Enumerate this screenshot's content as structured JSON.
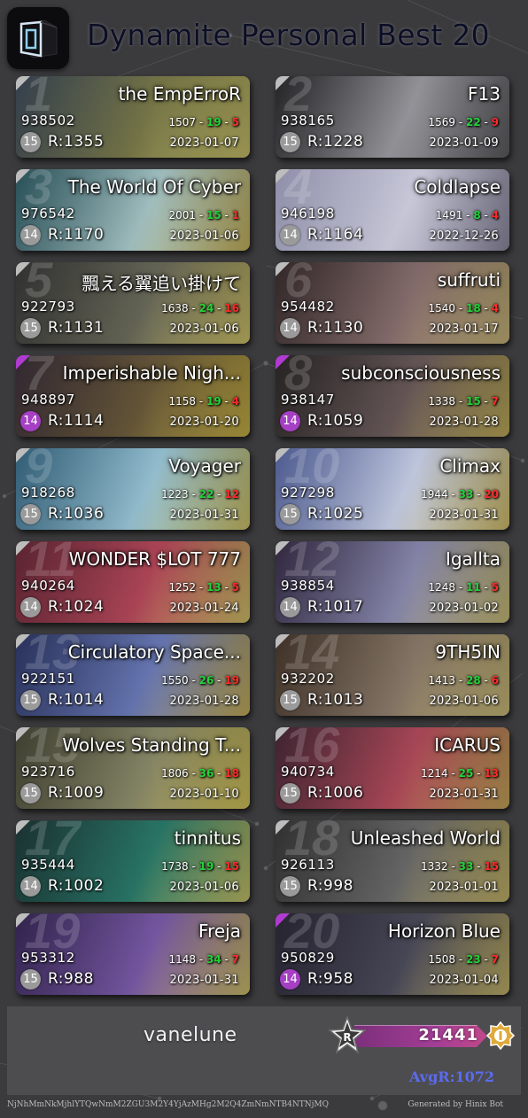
{
  "header": {
    "title": "Dynamite Personal Best 20",
    "logo_icon": "cube-logo-icon"
  },
  "theme": {
    "background": "#3b3b3d",
    "good_color": "#23d23a",
    "miss_color": "#ff2a2a",
    "diff_default_color": "#9a9a9a",
    "diff_14p_color": "#a53fc3",
    "avg_color": "#5b6cf0"
  },
  "cards": [
    {
      "rank": "1",
      "title": "the EmpErroR",
      "score": "938502",
      "perfect": "1507",
      "good": "19",
      "miss": "5",
      "level": "15",
      "rating": "R:1355",
      "date": "2023-01-07",
      "plus": false,
      "art": [
        "#3d4a5a",
        "#7a7a4a",
        "#c9c26a"
      ]
    },
    {
      "rank": "2",
      "title": "F13",
      "score": "938165",
      "perfect": "1569",
      "good": "22",
      "miss": "9",
      "level": "15",
      "rating": "R:1228",
      "date": "2023-01-09",
      "plus": false,
      "art": [
        "#2b2b2e",
        "#9a9aa0",
        "#5c5c60"
      ]
    },
    {
      "rank": "3",
      "title": "The World Of Cyber",
      "score": "976542",
      "perfect": "2001",
      "good": "15",
      "miss": "1",
      "level": "14",
      "rating": "R:1170",
      "date": "2023-01-06",
      "plus": false,
      "art": [
        "#2f5d66",
        "#a8c7c8",
        "#c7b35c"
      ]
    },
    {
      "rank": "4",
      "title": "Coldlapse",
      "score": "946198",
      "perfect": "1491",
      "good": "8",
      "miss": "4",
      "level": "14",
      "rating": "R:1164",
      "date": "2022-12-26",
      "plus": false,
      "art": [
        "#a8a8c8",
        "#d2d2e4",
        "#8d8aa0"
      ]
    },
    {
      "rank": "5",
      "title": "飄える翼追い掛けて",
      "score": "922793",
      "perfect": "1638",
      "good": "24",
      "miss": "16",
      "level": "15",
      "rating": "R:1131",
      "date": "2023-01-06",
      "plus": false,
      "art": [
        "#3a3a3a",
        "#6a6a5a",
        "#d0c46a"
      ]
    },
    {
      "rank": "6",
      "title": "suffruti",
      "score": "954482",
      "perfect": "1540",
      "good": "18",
      "miss": "4",
      "level": "14",
      "rating": "R:1130",
      "date": "2023-01-17",
      "plus": false,
      "art": [
        "#3b2e2e",
        "#8a7070",
        "#c9b77a"
      ]
    },
    {
      "rank": "7",
      "title": "Imperishable Nigh...",
      "score": "948897",
      "perfect": "1158",
      "good": "19",
      "miss": "4",
      "level": "14",
      "rating": "R:1114",
      "date": "2023-01-20",
      "plus": true,
      "art": [
        "#3a2f3a",
        "#6a5a3a",
        "#c9b246"
      ]
    },
    {
      "rank": "8",
      "title": "subconsciousness",
      "score": "938147",
      "perfect": "1338",
      "good": "15",
      "miss": "7",
      "level": "14",
      "rating": "R:1059",
      "date": "2023-01-28",
      "plus": true,
      "art": [
        "#2e2a2a",
        "#6a5a5a",
        "#c0ae5a"
      ]
    },
    {
      "rank": "9",
      "title": "Voyager",
      "score": "918268",
      "perfect": "1223",
      "good": "22",
      "miss": "12",
      "level": "15",
      "rating": "R:1036",
      "date": "2023-01-31",
      "plus": false,
      "art": [
        "#3a6d8a",
        "#9ac6d8",
        "#d0c468"
      ]
    },
    {
      "rank": "10",
      "title": "Climax",
      "score": "927298",
      "perfect": "1944",
      "good": "33",
      "miss": "20",
      "level": "15",
      "rating": "R:1025",
      "date": "2023-01-31",
      "plus": false,
      "art": [
        "#5a6aa8",
        "#c8d0e8",
        "#d4c06a"
      ]
    },
    {
      "rank": "11",
      "title": "WONDER $LOT 777",
      "score": "940264",
      "perfect": "1252",
      "good": "13",
      "miss": "5",
      "level": "14",
      "rating": "R:1024",
      "date": "2023-01-24",
      "plus": false,
      "art": [
        "#6a2a3a",
        "#b4485a",
        "#d4c46a"
      ]
    },
    {
      "rank": "12",
      "title": "Igallta",
      "score": "938854",
      "perfect": "1248",
      "good": "11",
      "miss": "5",
      "level": "14",
      "rating": "R:1017",
      "date": "2023-01-02",
      "plus": false,
      "art": [
        "#3a2f4a",
        "#8a8ab0",
        "#cabe76"
      ]
    },
    {
      "rank": "13",
      "title": "Circulatory Space...",
      "score": "922151",
      "perfect": "1550",
      "good": "26",
      "miss": "19",
      "level": "15",
      "rating": "R:1014",
      "date": "2023-01-28",
      "plus": false,
      "art": [
        "#2f3a6a",
        "#6a7ab8",
        "#c8b05a"
      ]
    },
    {
      "rank": "14",
      "title": "9TH5IN",
      "score": "932202",
      "perfect": "1413",
      "good": "28",
      "miss": "6",
      "level": "15",
      "rating": "R:1013",
      "date": "2023-01-06",
      "plus": false,
      "art": [
        "#4a3a2e",
        "#8a7a6a",
        "#cdbd7a"
      ]
    },
    {
      "rank": "15",
      "title": "Wolves Standing T...",
      "score": "923716",
      "perfect": "1806",
      "good": "36",
      "miss": "18",
      "level": "15",
      "rating": "R:1009",
      "date": "2023-01-10",
      "plus": false,
      "art": [
        "#4a4a3a",
        "#8a8a6a",
        "#d6c65a"
      ]
    },
    {
      "rank": "16",
      "title": "ICARUS",
      "score": "940734",
      "perfect": "1214",
      "good": "25",
      "miss": "13",
      "level": "15",
      "rating": "R:1006",
      "date": "2023-01-31",
      "plus": false,
      "art": [
        "#4a2a3a",
        "#b04a5a",
        "#c8a85a"
      ]
    },
    {
      "rank": "17",
      "title": "tinnitus",
      "score": "935444",
      "perfect": "1738",
      "good": "19",
      "miss": "15",
      "level": "14",
      "rating": "R:1002",
      "date": "2023-01-06",
      "plus": false,
      "art": [
        "#1f3a3a",
        "#2a7a6a",
        "#c8c46a"
      ]
    },
    {
      "rank": "18",
      "title": "Unleashed World",
      "score": "926113",
      "perfect": "1332",
      "good": "33",
      "miss": "15",
      "level": "15",
      "rating": "R:998",
      "date": "2023-01-01",
      "plus": false,
      "art": [
        "#3a3a3a",
        "#6a6a6a",
        "#c6b66a"
      ]
    },
    {
      "rank": "19",
      "title": "Freja",
      "score": "953312",
      "perfect": "1148",
      "good": "34",
      "miss": "7",
      "level": "15",
      "rating": "R:988",
      "date": "2023-01-31",
      "plus": false,
      "art": [
        "#3a2a5a",
        "#7a5aa8",
        "#d0c06a"
      ]
    },
    {
      "rank": "20",
      "title": "Horizon Blue",
      "score": "950829",
      "perfect": "1508",
      "good": "23",
      "miss": "7",
      "level": "14",
      "rating": "R:958",
      "date": "2023-01-04",
      "plus": true,
      "art": [
        "#2e2a3a",
        "#4a4a5a",
        "#c4b46a"
      ]
    }
  ],
  "footer": {
    "player_name": "vanelune",
    "total_rating": "21441",
    "r_badge_letter": "R",
    "avg_rating": "AvgR:1072",
    "hash": "NjNhMmNkMjhlYTQwNmM2ZGU3M2Y4YjAzMHg2M2Q4ZmNmNTB4NTNjMQ",
    "generated_by": "Generated by Hinix Bot"
  }
}
